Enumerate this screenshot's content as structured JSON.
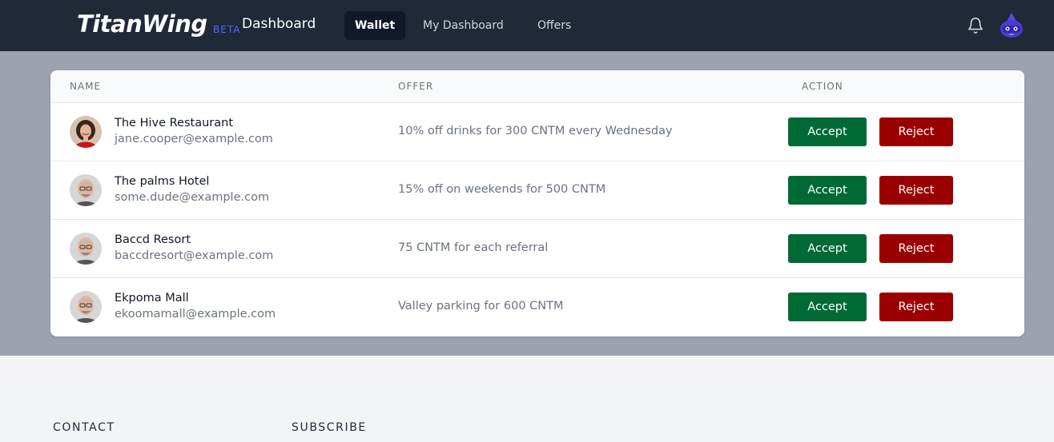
{
  "brand": {
    "name": "TitanWing",
    "badge": "BETA",
    "section_title": "Dashboard"
  },
  "nav": {
    "links": [
      {
        "label": "Wallet",
        "active": true
      },
      {
        "label": "My Dashboard"
      },
      {
        "label": "Offers"
      }
    ]
  },
  "icons": {
    "notifications": "bell-icon",
    "profile": "robot-avatar-icon"
  },
  "table": {
    "headers": {
      "name": "NAME",
      "offer": "OFFER",
      "action": "ACTION"
    },
    "rows": [
      {
        "name": "The Hive Restaurant",
        "email": "jane.cooper@example.com",
        "offer": "10% off drinks for 300 CNTM every Wednesday",
        "accept": "Accept",
        "reject": "Reject",
        "avatar": "woman-avatar"
      },
      {
        "name": "The palms Hotel",
        "email": "some.dude@example.com",
        "offer": "15% off on weekends for 500 CNTM",
        "accept": "Accept",
        "reject": "Reject",
        "avatar": "man-avatar"
      },
      {
        "name": "Baccd Resort",
        "email": "baccdresort@example.com",
        "offer": "75 CNTM for each referral",
        "accept": "Accept",
        "reject": "Reject",
        "avatar": "man-avatar"
      },
      {
        "name": "Ekpoma Mall",
        "email": "ekoomamall@example.com",
        "offer": "Valley parking for 600 CNTM",
        "accept": "Accept",
        "reject": "Reject",
        "avatar": "man-avatar"
      }
    ]
  },
  "footer": {
    "contact": "CONTACT",
    "subscribe": "SUBSCRIBE"
  },
  "colors": {
    "nav_bg": "#1f2937",
    "band_bg": "#9ca3af",
    "accept": "#006a34",
    "reject": "#9b0000",
    "beta": "#4f6bff"
  }
}
